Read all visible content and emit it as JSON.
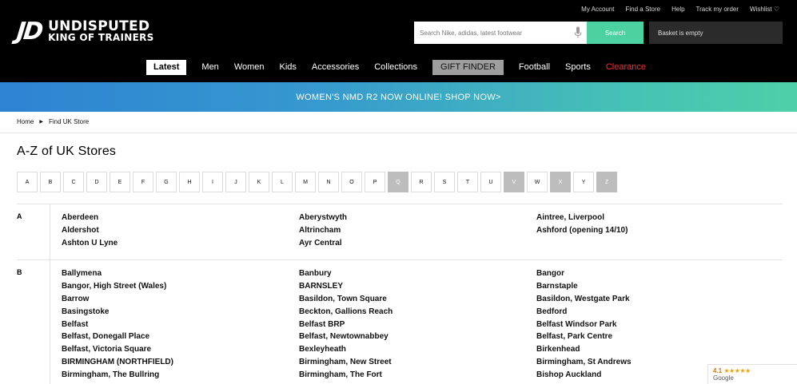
{
  "top_links": [
    "My Account",
    "Find a Store",
    "Help",
    "Track my order",
    "Wishlist ♡"
  ],
  "logo": {
    "mark": "JD",
    "line1": "UNDISPUTED",
    "line2": "KING OF TRAINERS"
  },
  "search": {
    "placeholder": "Search Nike, adidas, latest footwear",
    "button": "Search"
  },
  "basket": "Basket is empty",
  "nav": [
    "Latest",
    "Men",
    "Women",
    "Kids",
    "Accessories",
    "Collections",
    "GIFT FINDER",
    "Football",
    "Sports",
    "Clearance"
  ],
  "promo": "WOMEN'S NMD R2 NOW ONLINE! SHOP NOW>",
  "breadcrumb": {
    "home": "Home",
    "current": "Find UK Store"
  },
  "page_title": "A-Z of UK Stores",
  "letters": [
    {
      "l": "A",
      "on": true
    },
    {
      "l": "B",
      "on": true
    },
    {
      "l": "C",
      "on": true
    },
    {
      "l": "D",
      "on": true
    },
    {
      "l": "E",
      "on": true
    },
    {
      "l": "F",
      "on": true
    },
    {
      "l": "G",
      "on": true
    },
    {
      "l": "H",
      "on": true
    },
    {
      "l": "I",
      "on": true
    },
    {
      "l": "J",
      "on": true
    },
    {
      "l": "K",
      "on": true
    },
    {
      "l": "L",
      "on": true
    },
    {
      "l": "M",
      "on": true
    },
    {
      "l": "N",
      "on": true
    },
    {
      "l": "O",
      "on": true
    },
    {
      "l": "P",
      "on": true
    },
    {
      "l": "Q",
      "on": false
    },
    {
      "l": "R",
      "on": true
    },
    {
      "l": "S",
      "on": true
    },
    {
      "l": "T",
      "on": true
    },
    {
      "l": "U",
      "on": true
    },
    {
      "l": "V",
      "on": false
    },
    {
      "l": "W",
      "on": true
    },
    {
      "l": "X",
      "on": false
    },
    {
      "l": "Y",
      "on": true
    },
    {
      "l": "Z",
      "on": false
    }
  ],
  "sections": [
    {
      "letter": "A",
      "columns": [
        [
          "Aberdeen",
          "Aldershot",
          "Ashton U Lyne"
        ],
        [
          "Aberystwyth",
          "Altrincham",
          "Ayr Central"
        ],
        [
          "Aintree, Liverpool",
          "Ashford (opening 14/10)"
        ]
      ]
    },
    {
      "letter": "B",
      "columns": [
        [
          "Ballymena",
          "Bangor, High Street (Wales)",
          "Barrow",
          "Basingstoke",
          "Belfast",
          "Belfast, Donegall Place",
          "Belfast, Victoria Square",
          "BIRMINGHAM (NORTHFIELD)",
          "Birmingham, The Bullring"
        ],
        [
          "Banbury",
          "BARNSLEY",
          "Basildon, Town Square",
          "Beckton, Gallions Reach",
          "Belfast BRP",
          "Belfast, Newtownabbey",
          "Bexleyheath",
          "Birmingham, New Street",
          "Birmingham, The Fort"
        ],
        [
          "Bangor",
          "Barnstaple",
          "Basildon, Westgate Park",
          "Bedford",
          "Belfast Windsor Park",
          "Belfast, Park Centre",
          "Birkenhead",
          "Birmingham, St Andrews",
          "Bishop Auckland"
        ]
      ]
    }
  ],
  "rating": {
    "score": "4.1",
    "stars": "★★★★★",
    "source": "Google"
  },
  "colors": {
    "header_bg": "#000000",
    "search_accent": "#4cd1a0",
    "clearance": "#ff2a2a",
    "disabled_letter": "#bdbdbd"
  }
}
